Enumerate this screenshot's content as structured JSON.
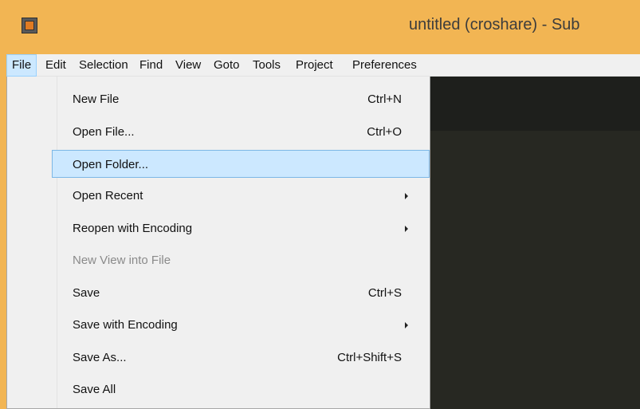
{
  "window": {
    "title": "untitled (croshare) - Sub"
  },
  "menubar": {
    "items": [
      {
        "label": "File"
      },
      {
        "label": "Edit"
      },
      {
        "label": "Selection"
      },
      {
        "label": "Find"
      },
      {
        "label": "View"
      },
      {
        "label": "Goto"
      },
      {
        "label": "Tools"
      },
      {
        "label": "Project"
      },
      {
        "label": "Preferences"
      }
    ]
  },
  "file_menu": {
    "items": [
      {
        "label": "New File",
        "shortcut": "Ctrl+N"
      },
      {
        "label": "Open File...",
        "shortcut": "Ctrl+O"
      },
      {
        "label": "Open Folder...",
        "shortcut": ""
      },
      {
        "label": "Open Recent",
        "shortcut": ""
      },
      {
        "label": "Reopen with Encoding",
        "shortcut": ""
      },
      {
        "label": "New View into File",
        "shortcut": ""
      },
      {
        "label": "Save",
        "shortcut": "Ctrl+S"
      },
      {
        "label": "Save with Encoding",
        "shortcut": ""
      },
      {
        "label": "Save As...",
        "shortcut": "Ctrl+Shift+S"
      },
      {
        "label": "Save All",
        "shortcut": ""
      }
    ]
  },
  "colors": {
    "titlebar": "#f2b553",
    "menu_highlight": "#cce8ff",
    "editor_background": "#272822"
  },
  "icons": {
    "app": "sublime-text-icon",
    "submenu": "chevron-right-icon"
  }
}
